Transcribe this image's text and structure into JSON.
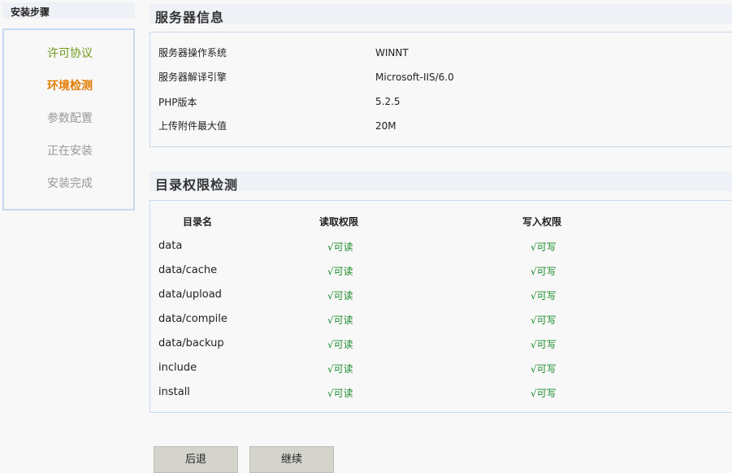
{
  "sidebar": {
    "title": "安装步骤",
    "steps": [
      {
        "label": "许可协议",
        "state": "done"
      },
      {
        "label": "环境检测",
        "state": "current"
      },
      {
        "label": "参数配置",
        "state": "pending"
      },
      {
        "label": "正在安装",
        "state": "pending"
      },
      {
        "label": "安装完成",
        "state": "pending"
      }
    ]
  },
  "server_info": {
    "title": "服务器信息",
    "rows": [
      {
        "label": "服务器操作系统",
        "value": "WINNT"
      },
      {
        "label": "服务器解译引擎",
        "value": "Microsoft-IIS/6.0"
      },
      {
        "label": "PHP版本",
        "value": "5.2.5"
      },
      {
        "label": "上传附件最大值",
        "value": "20M"
      }
    ]
  },
  "dir_check": {
    "title": "目录权限检测",
    "columns": {
      "name": "目录名",
      "read": "读取权限",
      "write": "写入权限"
    },
    "rows": [
      {
        "name": "data",
        "read": "√可读",
        "write": "√可写"
      },
      {
        "name": "data/cache",
        "read": "√可读",
        "write": "√可写"
      },
      {
        "name": "data/upload",
        "read": "√可读",
        "write": "√可写"
      },
      {
        "name": "data/compile",
        "read": "√可读",
        "write": "√可写"
      },
      {
        "name": "data/backup",
        "read": "√可读",
        "write": "√可写"
      },
      {
        "name": "include",
        "read": "√可读",
        "write": "√可写"
      },
      {
        "name": "install",
        "read": "√可读",
        "write": "√可写"
      }
    ]
  },
  "actions": {
    "back_label": "后退",
    "next_label": "继续"
  },
  "colors": {
    "done_step": "#6e9a19",
    "current_step": "#e07c00",
    "pending_step": "#999999",
    "permission_ok": "#1a8a2a",
    "panel_border": "#c6daf0"
  }
}
